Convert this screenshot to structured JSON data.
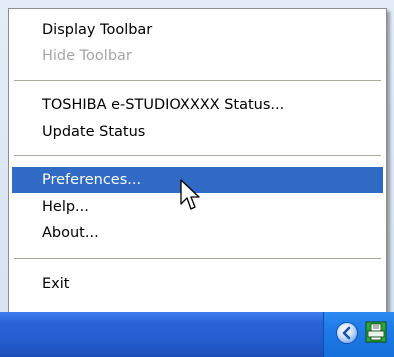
{
  "context_menu": {
    "items": [
      {
        "label": "Display Toolbar",
        "enabled": true
      },
      {
        "label": "Hide Toolbar",
        "enabled": false
      },
      {
        "label": "TOSHIBA e-STUDIOXXXX Status...",
        "enabled": true
      },
      {
        "label": "Update Status",
        "enabled": true
      },
      {
        "label": "Preferences...",
        "enabled": true,
        "selected": true
      },
      {
        "label": "Help...",
        "enabled": true
      },
      {
        "label": "About...",
        "enabled": true
      },
      {
        "label": "Exit",
        "enabled": true
      }
    ]
  },
  "taskbar": {
    "tray_icons": [
      "show-hidden-icons-chevron",
      "printer-status-icon"
    ]
  },
  "colors": {
    "selection": "#316ac5",
    "disabled_text": "#a6a6a6",
    "taskbar_blue": "#245ed0"
  }
}
